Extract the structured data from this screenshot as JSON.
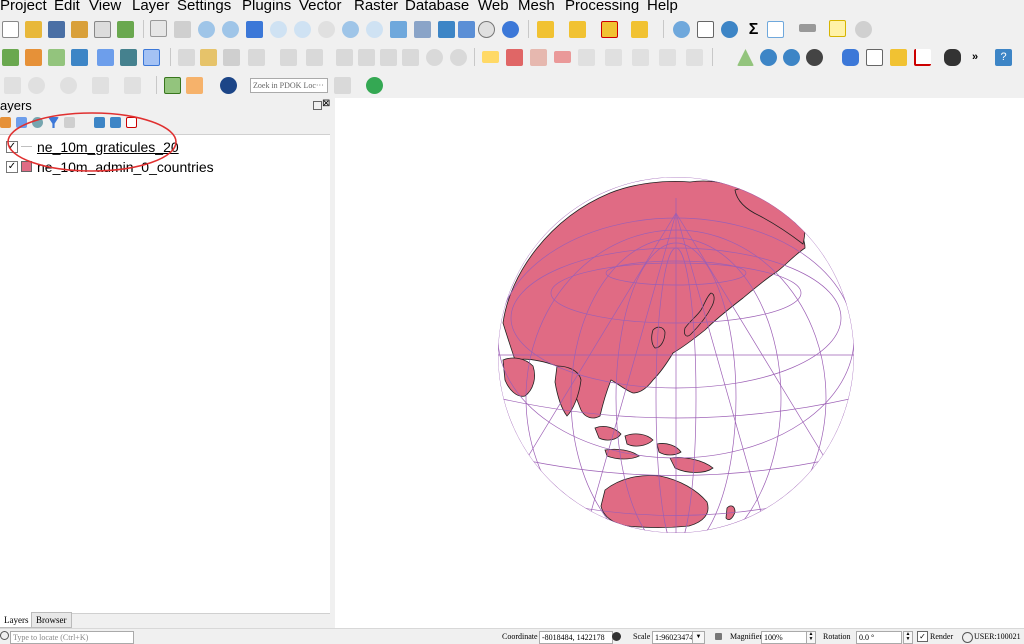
{
  "menu": [
    "Project",
    "Edit",
    "View",
    "Layer",
    "Settings",
    "Plugins",
    "Vector",
    "Raster",
    "Database",
    "Web",
    "Mesh",
    "Processing",
    "Help"
  ],
  "toolbar": {
    "pdok_search_placeholder": "Zoek in PDOK Loc···"
  },
  "layers_panel": {
    "title": "ayers",
    "layers": [
      {
        "name": "ne_10m_graticules_20",
        "checked": true,
        "symbol": "line",
        "color": "#bfbfbf"
      },
      {
        "name": "ne_10m_admin_0_countries",
        "checked": true,
        "symbol": "fill",
        "color": "#e06b84"
      }
    ],
    "tabs": [
      "Layers",
      "Browser (2)"
    ]
  },
  "map": {
    "land_color": "#e06b84",
    "graticule_color": "#9c5fb5"
  },
  "status": {
    "locate_placeholder": "Type to locate (Ctrl+K)",
    "coordinate_label": "Coordinate",
    "coordinate_value": "-8018484, 1422178",
    "scale_label": "Scale",
    "scale_value": "1:96023474",
    "magnifier_label": "Magnifier",
    "magnifier_value": "100%",
    "rotation_label": "Rotation",
    "rotation_value": "0.0 °",
    "render_label": "Render",
    "render_checked": true,
    "crs": "USER:100021"
  },
  "annotation": {
    "color": "#e03030"
  }
}
